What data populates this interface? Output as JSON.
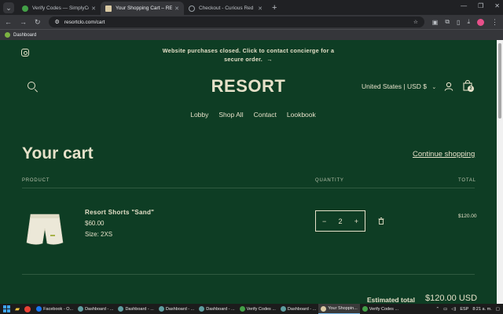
{
  "browser": {
    "tabs": [
      {
        "title": "Verify Codes — SimplyCodes",
        "active": false,
        "color": "#43a047"
      },
      {
        "title": "Your Shopping Cart – RESORT",
        "active": true,
        "color": "#d9c9a3"
      },
      {
        "title": "Checkout - Curious Red",
        "active": false,
        "color": "#9aa0a6"
      }
    ],
    "url": "resortclo.com/cart",
    "bookmarks": [
      {
        "label": "Dashboard"
      }
    ]
  },
  "site": {
    "announcement": "Website purchases closed. Click to contact concierge for a secure order.",
    "announcement_arrow": "→",
    "logo": "RESORT",
    "country": "United States | USD $",
    "cart_count": "2",
    "nav": [
      "Lobby",
      "Shop All",
      "Contact",
      "Lookbook"
    ],
    "accent": "#e6e1c9",
    "background": "#0e3d24"
  },
  "cart": {
    "title": "Your cart",
    "continue": "Continue shopping",
    "headers": {
      "product": "PRODUCT",
      "quantity": "QUANTITY",
      "total": "TOTAL"
    },
    "items": [
      {
        "name": "Resort Shorts \"Sand\"",
        "price": "$60.00",
        "size": "Size: 2XS",
        "quantity": "2",
        "line_total": "$120.00"
      }
    ],
    "estimated_label": "Estimated total",
    "estimated_value": "$120.00 USD"
  },
  "taskbar": {
    "items": [
      {
        "label": "Facebook - O...",
        "color": "#1877f2",
        "active": false
      },
      {
        "label": "Dashboard - ...",
        "color": "#5f9ea0",
        "active": false
      },
      {
        "label": "Dashboard - ...",
        "color": "#5f9ea0",
        "active": false
      },
      {
        "label": "Dashboard - ...",
        "color": "#5f9ea0",
        "active": false
      },
      {
        "label": "Dashboard - ...",
        "color": "#5f9ea0",
        "active": false
      },
      {
        "label": "Verify Codes ...",
        "color": "#43a047",
        "active": false
      },
      {
        "label": "Dashboard - ...",
        "color": "#5f9ea0",
        "active": false
      },
      {
        "label": "Your Shoppin...",
        "color": "#d9c9a3",
        "active": true
      },
      {
        "label": "Verify Codes ...",
        "color": "#43a047",
        "active": false
      }
    ],
    "lang": "ESP",
    "time": "8:21 a. m."
  }
}
